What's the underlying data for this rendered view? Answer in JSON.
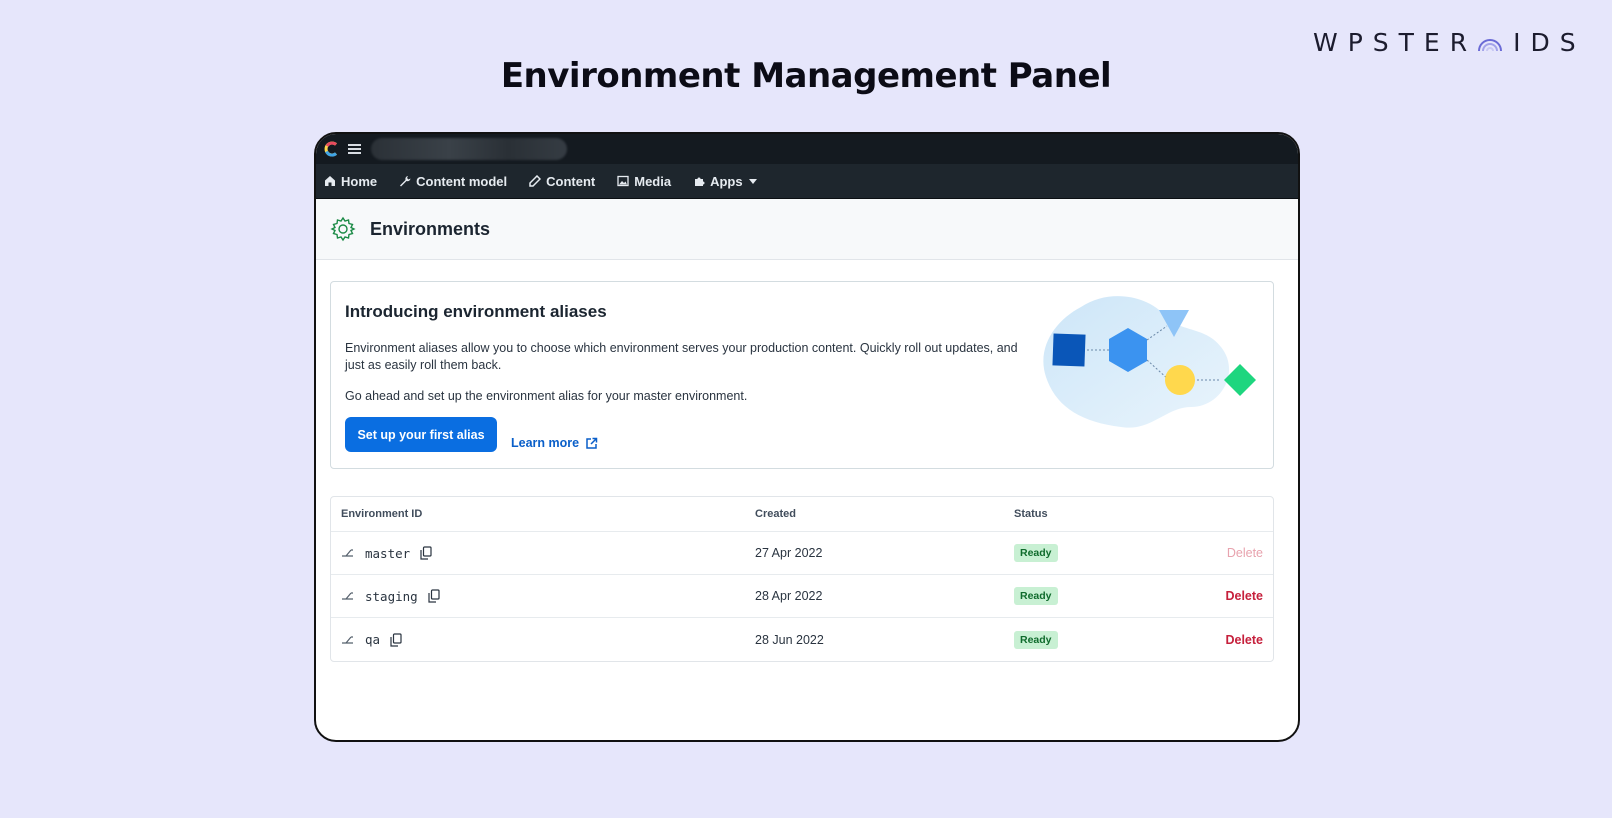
{
  "brand": {
    "left": "WPSTER",
    "right": "IDS"
  },
  "page_title": "Environment Management Panel",
  "nav": {
    "items": [
      {
        "label": "Home",
        "icon": "home-icon"
      },
      {
        "label": "Content model",
        "icon": "wrench-icon"
      },
      {
        "label": "Content",
        "icon": "pen-icon"
      },
      {
        "label": "Media",
        "icon": "image-icon"
      },
      {
        "label": "Apps",
        "icon": "puzzle-icon"
      }
    ]
  },
  "section": {
    "title": "Environments",
    "icon": "gear-icon"
  },
  "intro": {
    "title": "Introducing environment aliases",
    "paragraph1": "Environment aliases allow you to choose which environment serves your production content. Quickly roll out updates, and just as easily roll them back.",
    "paragraph2": "Go ahead and set up the environment alias for your master environment.",
    "primary_button": "Set up your first alias",
    "learn_more": "Learn more"
  },
  "table": {
    "headers": {
      "id": "Environment ID",
      "created": "Created",
      "status": "Status"
    },
    "rows": [
      {
        "id": "master",
        "created": "27 Apr 2022",
        "status": "Ready",
        "action": "Delete",
        "action_disabled": true
      },
      {
        "id": "staging",
        "created": "28 Apr 2022",
        "status": "Ready",
        "action": "Delete",
        "action_disabled": false
      },
      {
        "id": "qa",
        "created": "28 Jun 2022",
        "status": "Ready",
        "action": "Delete",
        "action_disabled": false
      }
    ]
  },
  "colors": {
    "page_background": "#e6e6fb",
    "primary": "#0a6ee1",
    "danger": "#c6203c",
    "success_badge": "#c8f0d3"
  }
}
